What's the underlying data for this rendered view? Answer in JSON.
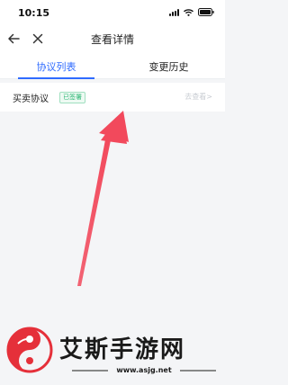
{
  "status_bar": {
    "time": "10:15"
  },
  "nav": {
    "title": "查看详情"
  },
  "tabs": [
    {
      "label": "协议列表",
      "active": true
    },
    {
      "label": "变更历史",
      "active": false
    }
  ],
  "agreements": [
    {
      "name": "买卖协议",
      "status": "已签署",
      "action": "去查看>"
    }
  ],
  "watermark": {
    "name": "艾斯手游网",
    "url": "www.asjg.net"
  },
  "colors": {
    "accent": "#2f6bff",
    "status_green": "#2bb673",
    "arrow_red": "#f2495c"
  }
}
